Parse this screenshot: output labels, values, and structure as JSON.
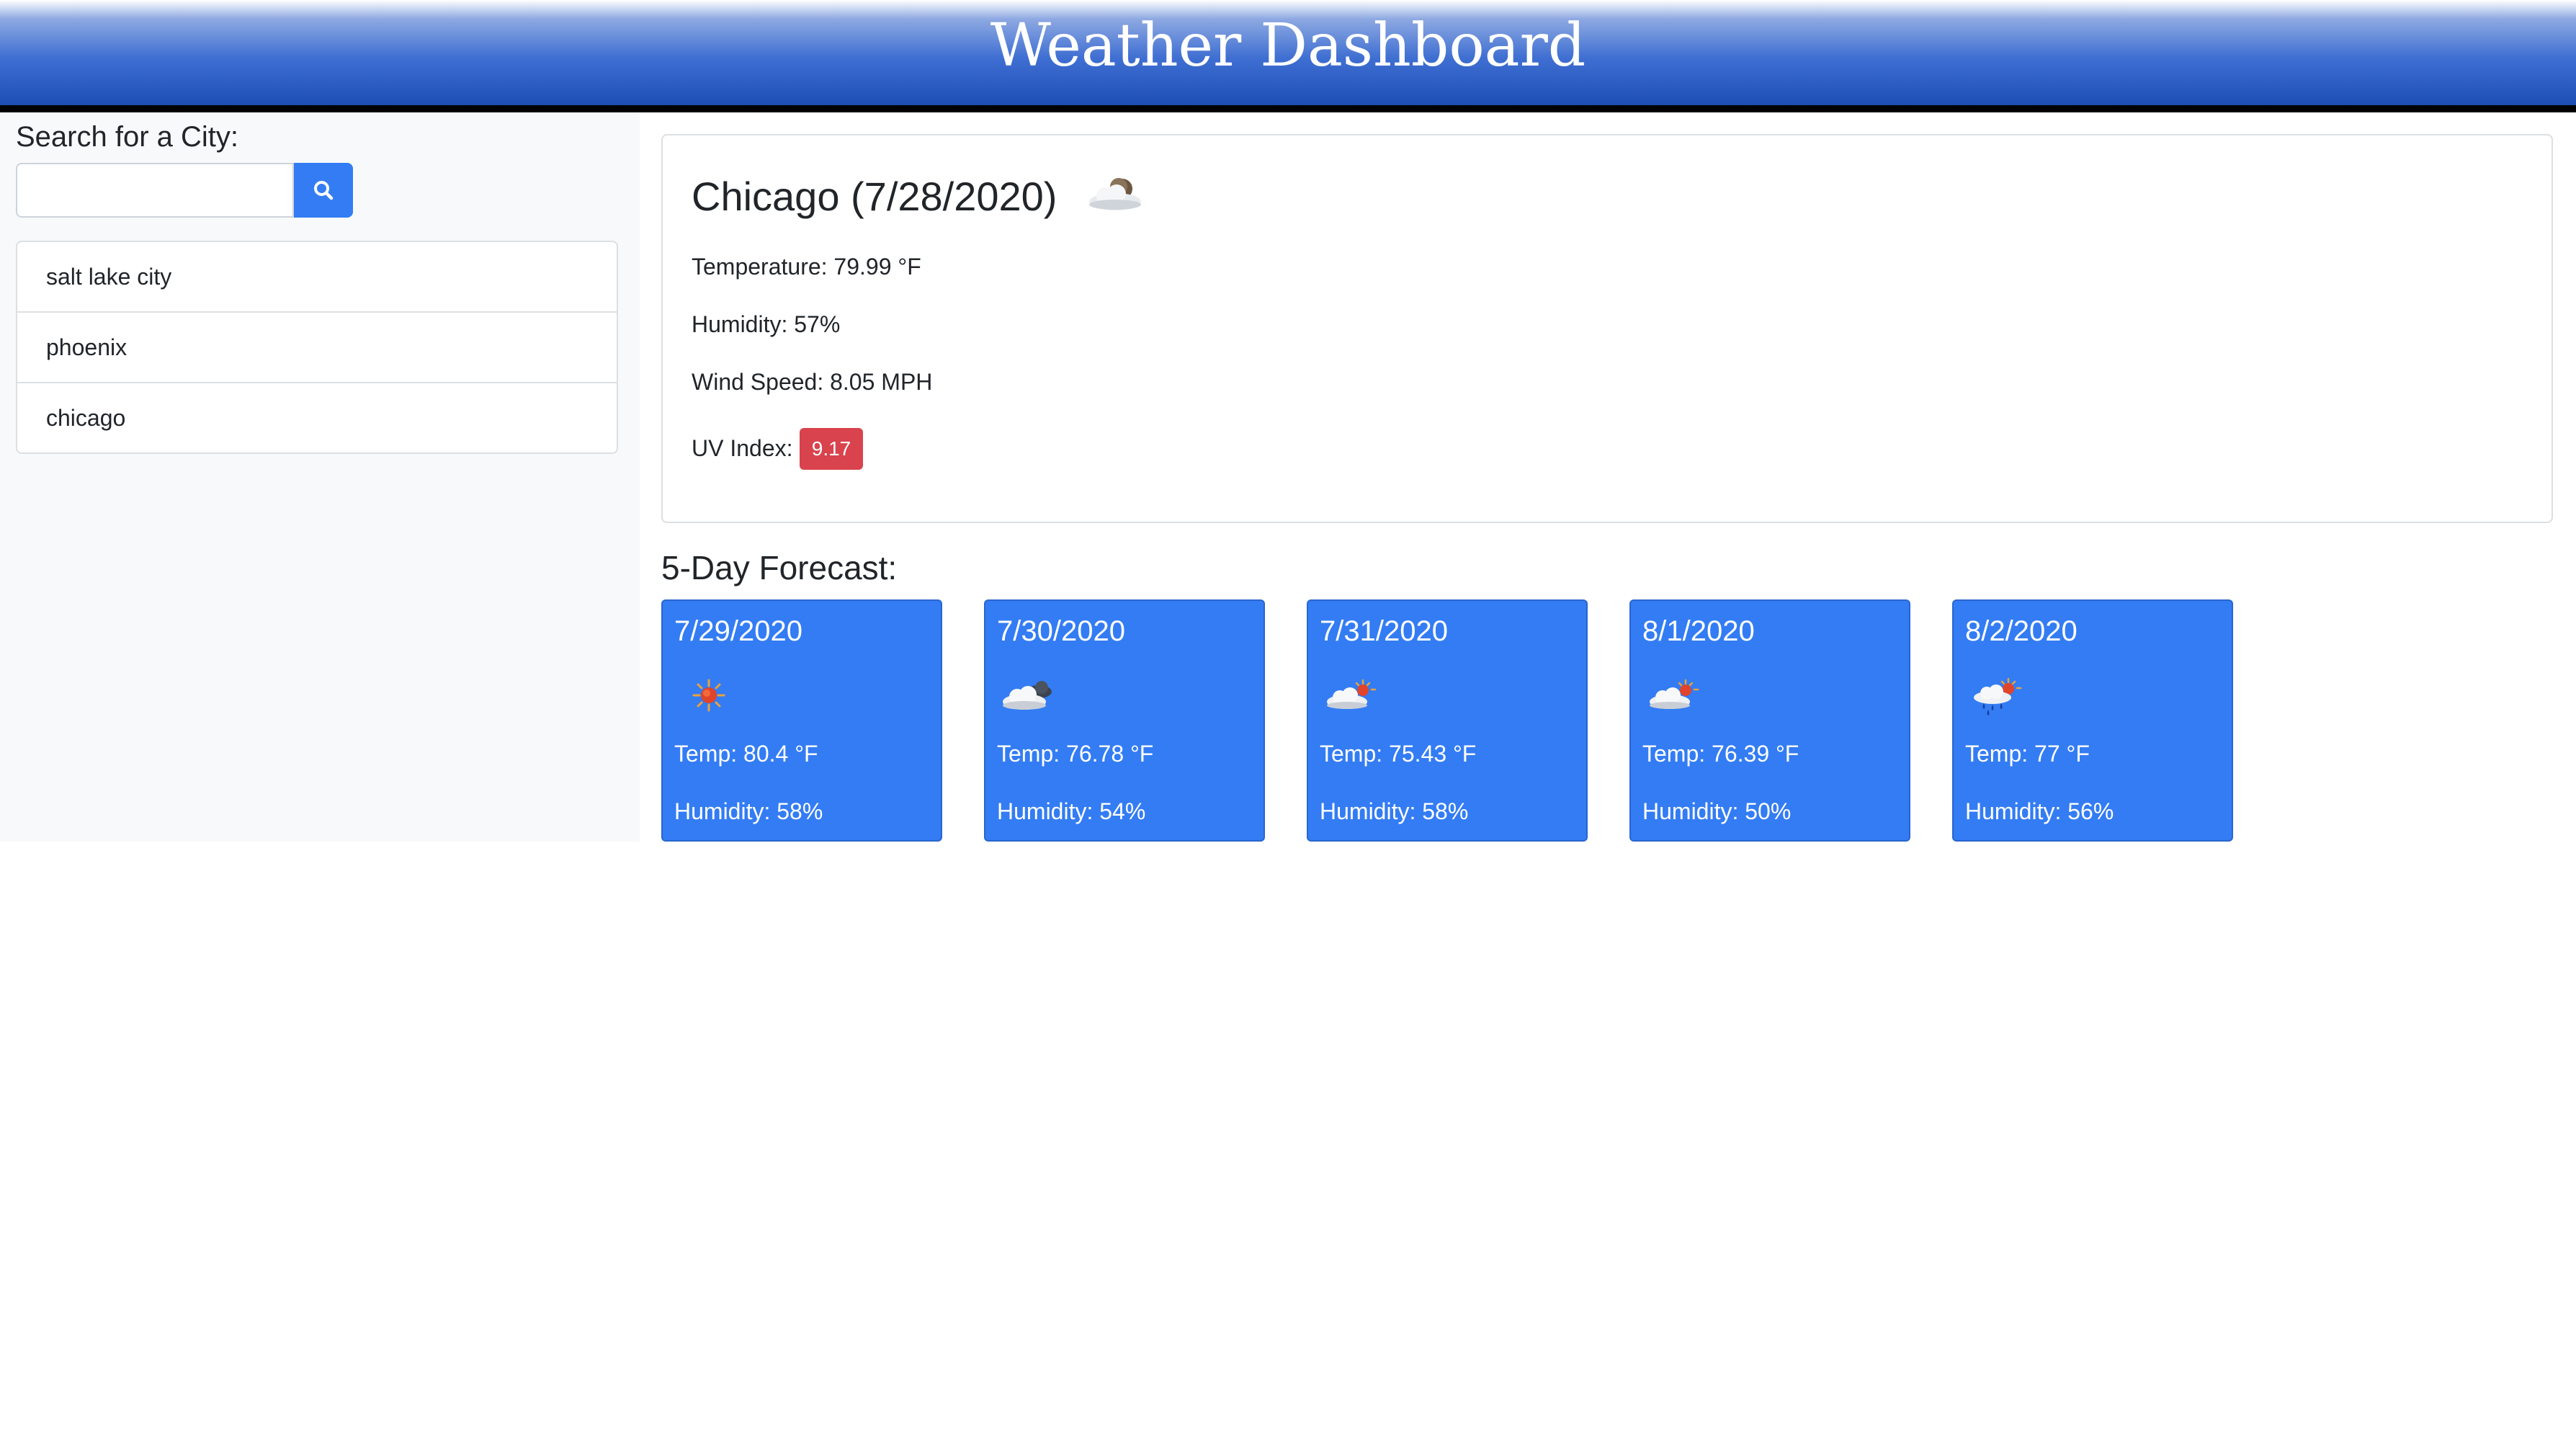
{
  "header": {
    "title": "Weather Dashboard"
  },
  "sidebar": {
    "search_label": "Search for a City:",
    "search_value": "",
    "search_placeholder": "",
    "search_button_icon": "search-icon",
    "history": [
      {
        "label": "salt lake city"
      },
      {
        "label": "phoenix"
      },
      {
        "label": "chicago"
      }
    ]
  },
  "current": {
    "title": "Chicago (7/28/2020)",
    "icon": "partly-cloudy-night-icon",
    "temperature": "Temperature: 79.99 °F",
    "humidity": "Humidity: 57%",
    "wind": "Wind Speed: 8.05 MPH",
    "uv_label": "UV Index:",
    "uv_value": "9.17",
    "uv_color": "#d9434d"
  },
  "forecast": {
    "heading": "5-Day Forecast:",
    "card_color": "#337cf4",
    "days": [
      {
        "date": "7/29/2020",
        "icon": "sun-icon",
        "temp": "Temp: 80.4 °F",
        "humidity": "Humidity: 58%"
      },
      {
        "date": "7/30/2020",
        "icon": "cloudy-night-icon",
        "temp": "Temp: 76.78 °F",
        "humidity": "Humidity: 54%"
      },
      {
        "date": "7/31/2020",
        "icon": "partly-cloudy-day-icon",
        "temp": "Temp: 75.43 °F",
        "humidity": "Humidity: 58%"
      },
      {
        "date": "8/1/2020",
        "icon": "partly-cloudy-day-icon",
        "temp": "Temp: 76.39 °F",
        "humidity": "Humidity: 50%"
      },
      {
        "date": "8/2/2020",
        "icon": "rain-sun-icon",
        "temp": "Temp: 77 °F",
        "humidity": "Humidity: 56%"
      }
    ]
  }
}
